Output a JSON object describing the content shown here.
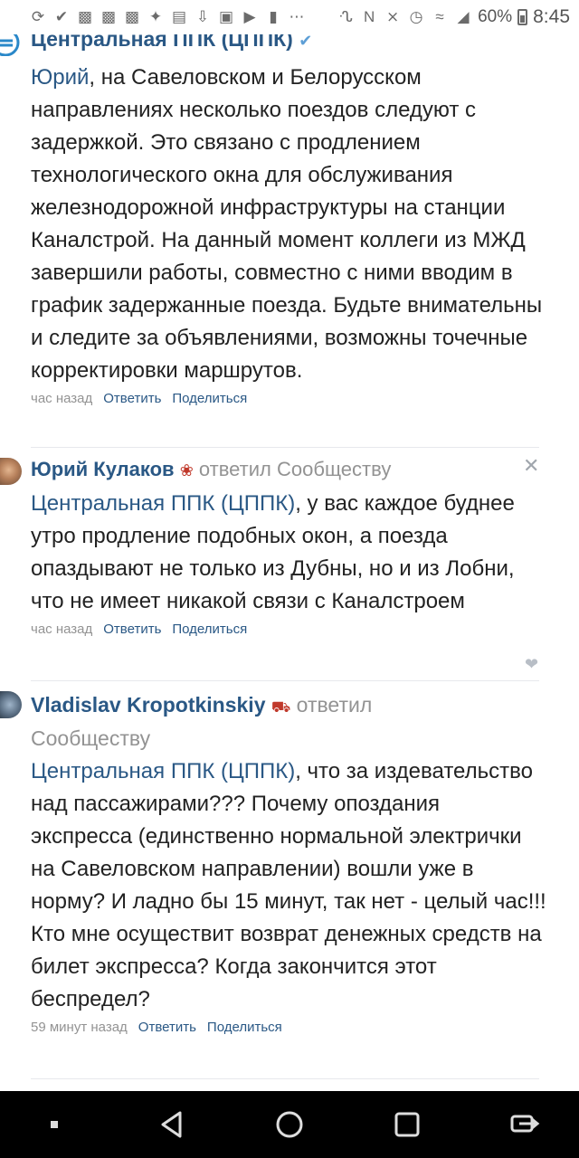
{
  "status_bar": {
    "battery_percent": "60%",
    "time": "8:45",
    "icons": [
      "sync-icon",
      "check-circle-icon",
      "vk-icon",
      "vk-icon",
      "vk-icon",
      "twitter-icon",
      "news-icon",
      "download-icon",
      "image-icon",
      "youtube-icon",
      "battery-saver-icon",
      "more-icon",
      "bluetooth-icon",
      "nfc-icon",
      "mute-icon",
      "alarm-icon",
      "wifi-icon",
      "signal-icon",
      "battery-icon"
    ]
  },
  "comments": [
    {
      "author": "Центральная ППК (ЦППК)",
      "verified": true,
      "mention": "Юрий",
      "text": ", на Савеловском и Белорусском направлениях несколько поездов следуют с задержкой. Это связано с продлением технологического окна для обслуживания железнодорожной инфраструктуры на станции Каналстрой. На данный момент коллеги из МЖД завершили работы, совместно с ними вводим в график задержанные поезда. Будьте внимательны и следите за объявлениями, возможны точечные корректировки маршрутов.",
      "time": "час назад",
      "reply_label": "Ответить",
      "share_label": "Поделиться"
    },
    {
      "author": "Юрий Кулаков",
      "replied_label": "ответил Сообществу",
      "mention": "Центральная ППК (ЦППК)",
      "text": ", у вас каждое буднее утро продление подобных окон, а поезда опаздывают не только из Дубны, но и из Лобни, что не имеет никакой связи с Каналстроем",
      "time": "час назад",
      "reply_label": "Ответить",
      "share_label": "Поделиться"
    },
    {
      "author": "Vladislav Kropotkinskiy",
      "replied_label": "ответил",
      "replied_label_2": "Сообществу",
      "mention": "Центральная ППК (ЦППК)",
      "text": ", что за издевательство над пассажирами??? Почему опоздания экспресса (единственно нормальной электрички на Савеловском направлении) вошли уже в норму? И ладно бы 15 минут, так нет - целый час!!!",
      "text_2": "Кто мне осуществит возврат денежных средств на билет экспресса? Когда закончится этот беспредел?",
      "time": "59 минут назад",
      "reply_label": "Ответить",
      "share_label": "Поделиться"
    }
  ],
  "colors": {
    "link": "#2a5885",
    "meta": "#939393",
    "text": "#222222",
    "divider": "#e7e8ec",
    "navbar": "#000000"
  }
}
